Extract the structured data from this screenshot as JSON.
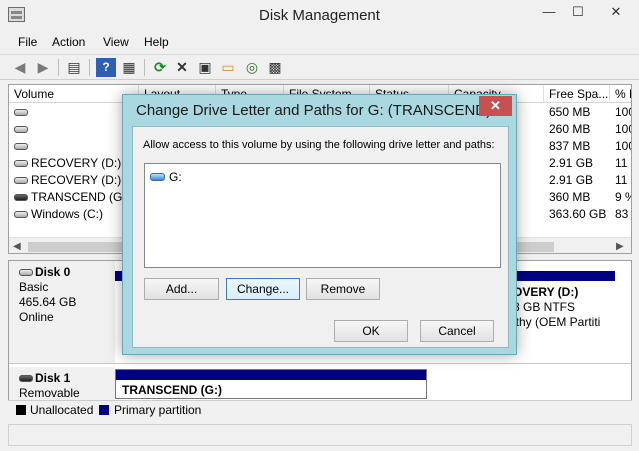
{
  "window": {
    "title": "Disk Management",
    "minimize": "—",
    "maximize": "☐",
    "close": "✕"
  },
  "menu": [
    "File",
    "Action",
    "View",
    "Help"
  ],
  "toolbar": {
    "back": "◀",
    "forward": "▶",
    "console": "▤",
    "help": "?",
    "properties_pane": "▦",
    "refresh": "⟳",
    "delete": "✕",
    "properties": "▣",
    "open": "▭",
    "search": "◎",
    "settings": "▩"
  },
  "volumes": {
    "columns": [
      "Volume",
      "Layout",
      "Type",
      "File System",
      "Status",
      "Capacity",
      "Free Spa...",
      "% F"
    ],
    "rows": [
      {
        "name": "",
        "free": "650 MB",
        "pct": "100"
      },
      {
        "name": "",
        "free": "260 MB",
        "pct": "100"
      },
      {
        "name": "",
        "free": "837 MB",
        "pct": "100"
      },
      {
        "name": "RECOVERY (D:)",
        "free": "2.91 GB",
        "pct": "11"
      },
      {
        "name": "RECOVERY (D:)",
        "free": "2.91 GB",
        "pct": "11"
      },
      {
        "name": "TRANSCEND (G:)",
        "free": "360 MB",
        "pct": "9 %"
      },
      {
        "name": "Windows (C:)",
        "free": "363.60 GB",
        "pct": "83"
      }
    ],
    "scroll_left": "◀",
    "scroll_right": "▶"
  },
  "disks": [
    {
      "name": "Disk 0",
      "type": "Basic",
      "size": "465.64 GB",
      "status": "Online",
      "partition": {
        "line1": "OVERY  (D:)",
        "line2": "8 GB NTFS",
        "line3": "lthy (OEM Partiti"
      }
    },
    {
      "name": "Disk 1",
      "type": "Removable",
      "partition": {
        "line1": "TRANSCEND  (G:)"
      }
    }
  ],
  "legend": {
    "unallocated": "Unallocated",
    "primary": "Primary partition"
  },
  "dialog": {
    "title": "Change Drive Letter and Paths for G: (TRANSCEND)",
    "close": "✕",
    "instruction": "Allow access to this volume by using the following drive letter and paths:",
    "paths": [
      "G:"
    ],
    "add": "Add...",
    "change": "Change...",
    "remove": "Remove",
    "ok": "OK",
    "cancel": "Cancel"
  },
  "colors": {
    "primary_partition": "#000080",
    "unallocated": "#000000",
    "dialog_frame": "#a9d8e0",
    "close_red": "#c75050"
  }
}
